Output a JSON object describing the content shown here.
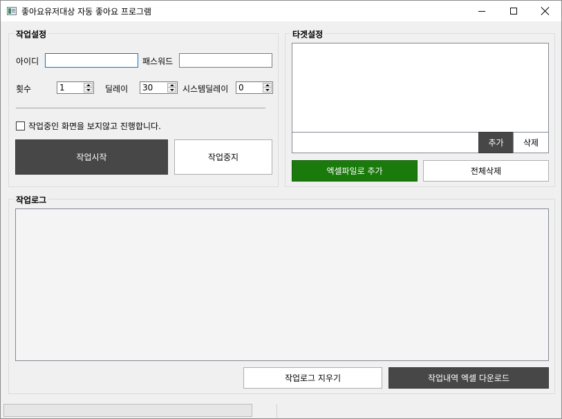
{
  "window": {
    "title": "좋아요유저대상 자동 좋아요 프로그램",
    "icon": "app-window-icon"
  },
  "task_settings": {
    "title": "작업설정",
    "id_label": "아이디",
    "id_value": "",
    "password_label": "패스워드",
    "password_value": "",
    "count_label": "횟수",
    "count_value": "1",
    "delay_label": "딜레이",
    "delay_value": "30",
    "system_delay_label": "시스템딜레이",
    "system_delay_value": "0",
    "hide_browser_label": "작업중인 화면을 보지않고 진행합니다.",
    "hide_browser_checked": false,
    "start_button": "작업시작",
    "stop_button": "작업중지"
  },
  "target_settings": {
    "title": "타겟설정",
    "target_list": [],
    "target_input_value": "",
    "add_button": "추가",
    "delete_button": "삭제",
    "excel_add_button": "엑셀파일로 추가",
    "delete_all_button": "전체삭제",
    "excel_button_color": "#1a7a0c"
  },
  "work_log": {
    "title": "작업로그",
    "log_text": "",
    "clear_button": "작업로그 지우기",
    "download_button": "작업내역 엑셀 다운로드"
  },
  "status": {
    "progress": 0
  }
}
